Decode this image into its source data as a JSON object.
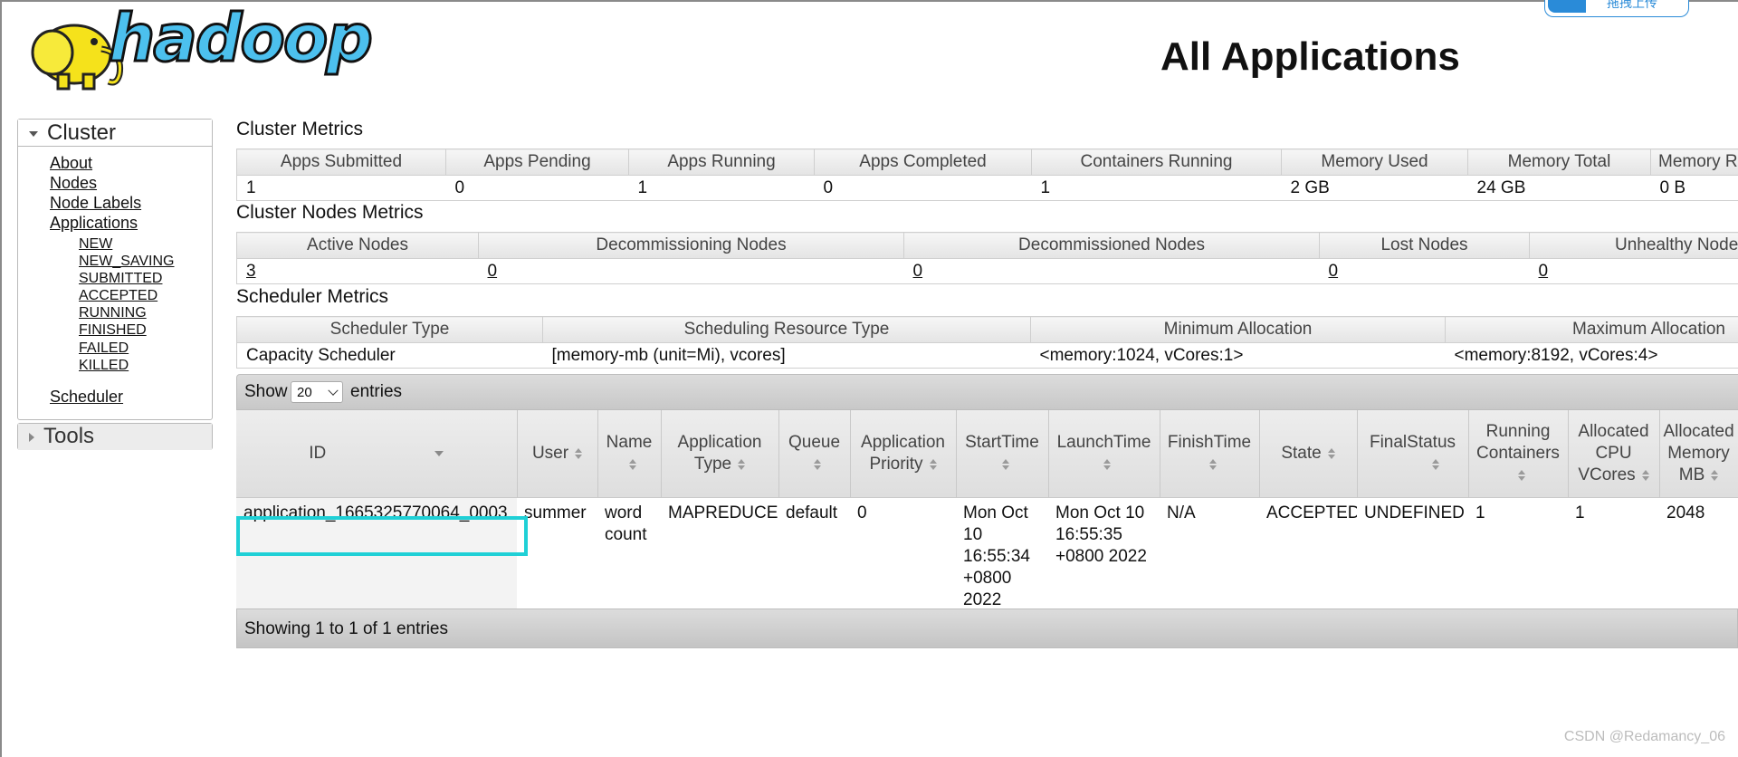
{
  "header": {
    "logo_text": "hadoop",
    "page_title": "All Applications",
    "upload_label": "拖拽上传"
  },
  "sidebar": {
    "cluster": {
      "title": "Cluster",
      "items": [
        "About",
        "Nodes",
        "Node Labels",
        "Applications"
      ],
      "app_states": [
        "NEW",
        "NEW_SAVING",
        "SUBMITTED",
        "ACCEPTED",
        "RUNNING",
        "FINISHED",
        "FAILED",
        "KILLED"
      ],
      "scheduler": "Scheduler"
    },
    "tools": {
      "title": "Tools"
    }
  },
  "cluster_metrics": {
    "title": "Cluster Metrics",
    "headers": [
      "Apps Submitted",
      "Apps Pending",
      "Apps Running",
      "Apps Completed",
      "Containers Running",
      "Memory Used",
      "Memory Total",
      "Memory Reserved"
    ],
    "values": [
      "1",
      "0",
      "1",
      "0",
      "1",
      "2 GB",
      "24 GB",
      "0 B"
    ]
  },
  "nodes_metrics": {
    "title": "Cluster Nodes Metrics",
    "headers": [
      "Active Nodes",
      "Decommissioning Nodes",
      "Decommissioned Nodes",
      "Lost Nodes",
      "Unhealthy Nodes"
    ],
    "values": [
      "3",
      "0",
      "0",
      "0",
      "0"
    ]
  },
  "scheduler_metrics": {
    "title": "Scheduler Metrics",
    "headers": [
      "Scheduler Type",
      "Scheduling Resource Type",
      "Minimum Allocation",
      "Maximum Allocation"
    ],
    "values": [
      "Capacity Scheduler",
      "[memory-mb (unit=Mi), vcores]",
      "<memory:1024, vCores:1>",
      "<memory:8192, vCores:4>"
    ]
  },
  "apps_table": {
    "show_label": "Show",
    "page_length": "20",
    "entries_label": "entries",
    "headers": [
      "ID",
      "User",
      "Name",
      "Application Type",
      "Queue",
      "Application Priority",
      "StartTime",
      "LaunchTime",
      "FinishTime",
      "State",
      "FinalStatus",
      "Running Containers",
      "Allocated CPU VCores",
      "Allocated Memory MB"
    ],
    "rows": [
      {
        "id": "application_1665325770064_0003",
        "user": "summer",
        "name": "word count",
        "type": "MAPREDUCE",
        "queue": "default",
        "priority": "0",
        "start_time": "Mon Oct 10 16:55:34 +0800 2022",
        "launch_time": "Mon Oct 10 16:55:35 +0800 2022",
        "finish_time": "N/A",
        "state": "ACCEPTED",
        "final_status": "UNDEFINED",
        "running_containers": "1",
        "allocated_vcores": "1",
        "allocated_memory": "2048"
      }
    ],
    "footer": "Showing 1 to 1 of 1 entries"
  },
  "watermark": "CSDN @Redamancy_06",
  "colors": {
    "highlight": "#1fd0d6",
    "logo_blue": "#4cc0ee",
    "logo_yellow": "#f5e21b"
  }
}
